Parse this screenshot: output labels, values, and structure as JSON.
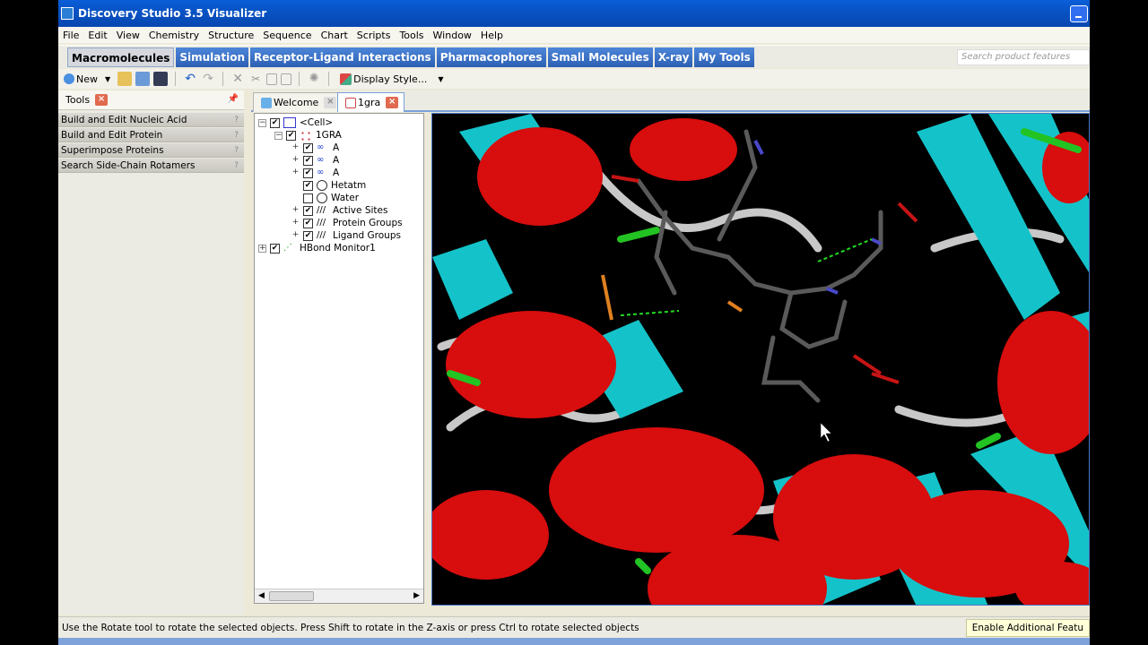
{
  "window": {
    "title": "Discovery Studio 3.5 Visualizer"
  },
  "menu": [
    "File",
    "Edit",
    "View",
    "Chemistry",
    "Structure",
    "Sequence",
    "Chart",
    "Scripts",
    "Tools",
    "Window",
    "Help"
  ],
  "ribbon_tabs": [
    "Macromolecules",
    "Simulation",
    "Receptor-Ligand Interactions",
    "Pharmacophores",
    "Small Molecules",
    "X-ray",
    "My Tools"
  ],
  "search": {
    "placeholder": "Search product features"
  },
  "toolbar": {
    "new_label": "New",
    "display_style_label": "Display Style..."
  },
  "tools_panel": {
    "title": "Tools",
    "items": [
      "Build and Edit Nucleic Acid",
      "Build and Edit Protein",
      "Superimpose Proteins",
      "Search Side-Chain Rotamers"
    ]
  },
  "doc_tabs": [
    "Welcome",
    "1gra"
  ],
  "tree": {
    "cell": "<Cell>",
    "molecule": "1GRA",
    "chain1": "A",
    "chain2": "A",
    "chain3": "A",
    "hetatm": "Hetatm",
    "water": "Water",
    "active_sites": "Active Sites",
    "protein_groups": "Protein Groups",
    "ligand_groups": "Ligand Groups",
    "hbond": "HBond Monitor1"
  },
  "status": {
    "message": "Use the Rotate tool to rotate the selected objects. Press Shift to rotate in the Z-axis or press Ctrl to rotate selected objects",
    "feature": "Enable Additional Featu"
  },
  "colors": {
    "helix": "#d80d0d",
    "sheet": "#14c3c9",
    "coil": "#c8c8c8",
    "ligand": "#555555",
    "hbond": "#22dd22"
  }
}
